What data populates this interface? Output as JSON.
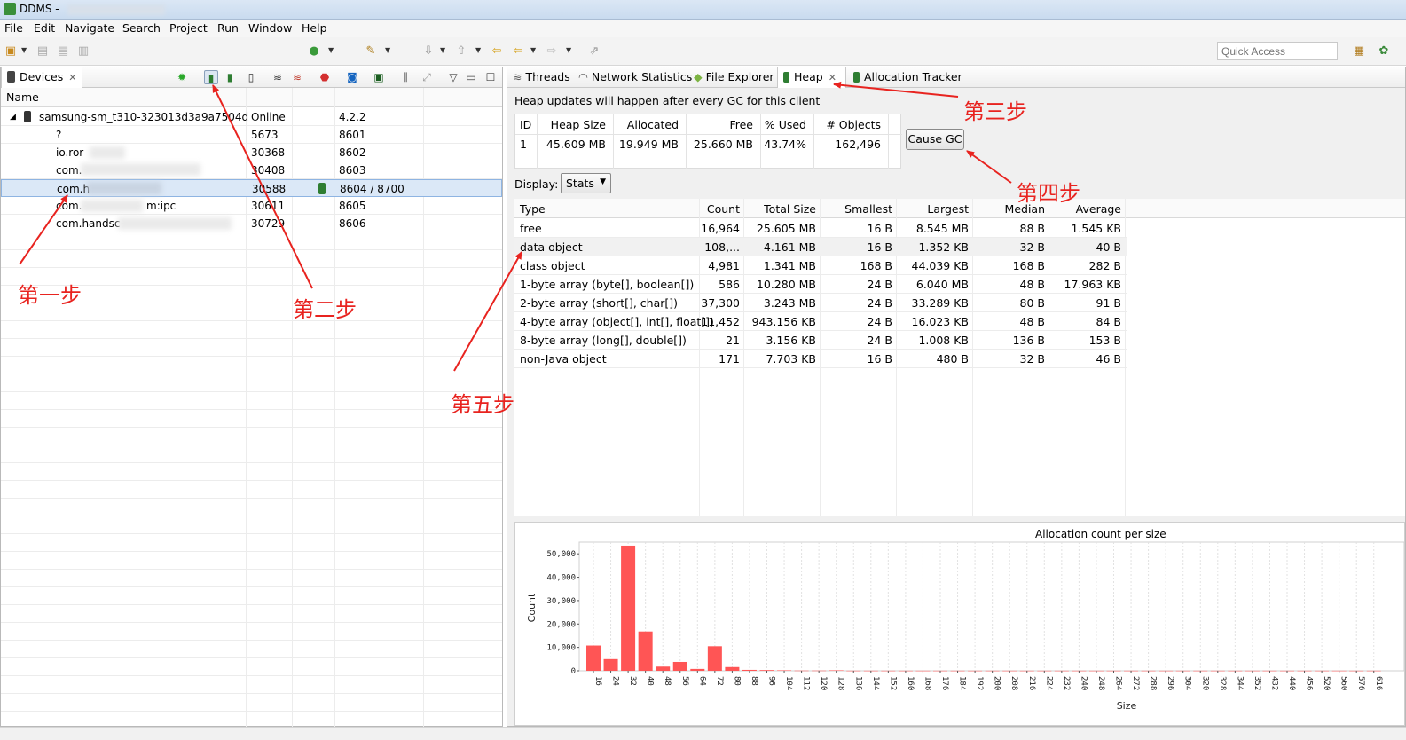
{
  "window": {
    "title": "DDMS - "
  },
  "menu": [
    "File",
    "Edit",
    "Navigate",
    "Search",
    "Project",
    "Run",
    "Window",
    "Help"
  ],
  "toolbar": {
    "quick_access_placeholder": "Quick Access"
  },
  "devices_view": {
    "tab_label": "Devices",
    "column_name": "Name",
    "device": {
      "name": "samsung-sm_t310-323013d3a9a7504d",
      "status": "Online",
      "version": "4.2.2"
    },
    "clients": [
      {
        "name": "?",
        "pid": "5673",
        "port": "8601",
        "selected": false
      },
      {
        "name": "io.ror",
        "pid": "30368",
        "port": "8602",
        "selected": false
      },
      {
        "name": "com.",
        "pid": "30408",
        "port": "8603",
        "selected": false
      },
      {
        "name": "com.h",
        "pid": "30588",
        "port": "8604 / 8700",
        "selected": true
      },
      {
        "name": "com.",
        "suffix": "m:ipc",
        "pid": "30611",
        "port": "8605",
        "selected": false
      },
      {
        "name": "com.handsc",
        "pid": "30729",
        "port": "8606",
        "selected": false
      }
    ]
  },
  "right_tabs": [
    "Threads",
    "Network Statistics",
    "File Explorer",
    "Heap",
    "Allocation Tracker"
  ],
  "heap": {
    "message": "Heap updates will happen after every GC for this client",
    "summary_headers": [
      "ID",
      "Heap Size",
      "Allocated",
      "Free",
      "% Used",
      "# Objects"
    ],
    "summary_values": [
      "1",
      "45.609 MB",
      "19.949 MB",
      "25.660 MB",
      "43.74%",
      "162,496"
    ],
    "cause_gc_label": "Cause GC",
    "display_label": "Display:",
    "display_value": "Stats",
    "stats_headers": [
      "Type",
      "Count",
      "Total Size",
      "Smallest",
      "Largest",
      "Median",
      "Average"
    ],
    "stats_rows": [
      [
        "free",
        "16,964",
        "25.605 MB",
        "16 B",
        "8.545 MB",
        "88 B",
        "1.545 KB"
      ],
      [
        "data object",
        "108,...",
        "4.161 MB",
        "16 B",
        "1.352 KB",
        "32 B",
        "40 B"
      ],
      [
        "class object",
        "4,981",
        "1.341 MB",
        "168 B",
        "44.039 KB",
        "168 B",
        "282 B"
      ],
      [
        "1-byte array (byte[], boolean[])",
        "586",
        "10.280 MB",
        "24 B",
        "6.040 MB",
        "48 B",
        "17.963 KB"
      ],
      [
        "2-byte array (short[], char[])",
        "37,300",
        "3.243 MB",
        "24 B",
        "33.289 KB",
        "80 B",
        "91 B"
      ],
      [
        "4-byte array (object[], int[], float[])",
        "11,452",
        "943.156 KB",
        "24 B",
        "16.023 KB",
        "48 B",
        "84 B"
      ],
      [
        "8-byte array (long[], double[])",
        "21",
        "3.156 KB",
        "24 B",
        "1.008 KB",
        "136 B",
        "153 B"
      ],
      [
        "non-Java object",
        "171",
        "7.703 KB",
        "16 B",
        "480 B",
        "32 B",
        "46 B"
      ]
    ]
  },
  "chart_data": {
    "type": "bar",
    "title": "Allocation count per size",
    "xlabel": "Size",
    "ylabel": "Count",
    "ylim": [
      0,
      55000
    ],
    "yticks": [
      "0",
      "10,000",
      "20,000",
      "30,000",
      "40,000",
      "50,000"
    ],
    "categories": [
      "16",
      "24",
      "32",
      "40",
      "48",
      "56",
      "64",
      "72",
      "80",
      "88",
      "96",
      "104",
      "112",
      "120",
      "128",
      "136",
      "144",
      "152",
      "160",
      "168",
      "176",
      "184",
      "192",
      "200",
      "208",
      "216",
      "224",
      "232",
      "240",
      "248",
      "264",
      "272",
      "288",
      "296",
      "304",
      "320",
      "328",
      "344",
      "352",
      "432",
      "440",
      "456",
      "520",
      "560",
      "576",
      "616"
    ],
    "values": [
      10800,
      5000,
      53500,
      16800,
      1800,
      3800,
      800,
      10500,
      1600,
      400,
      300,
      200,
      100,
      100,
      200,
      50,
      50,
      50,
      50,
      50,
      50,
      50,
      50,
      50,
      50,
      50,
      50,
      50,
      50,
      50,
      50,
      50,
      50,
      50,
      50,
      50,
      50,
      50,
      50,
      50,
      50,
      50,
      50,
      50,
      50,
      50
    ],
    "color": "#ff5555"
  },
  "annotations": {
    "step1": "第一步",
    "step2": "第二步",
    "step3": "第三步",
    "step4": "第四步",
    "step5": "第五步",
    "color": "#e8231f"
  }
}
